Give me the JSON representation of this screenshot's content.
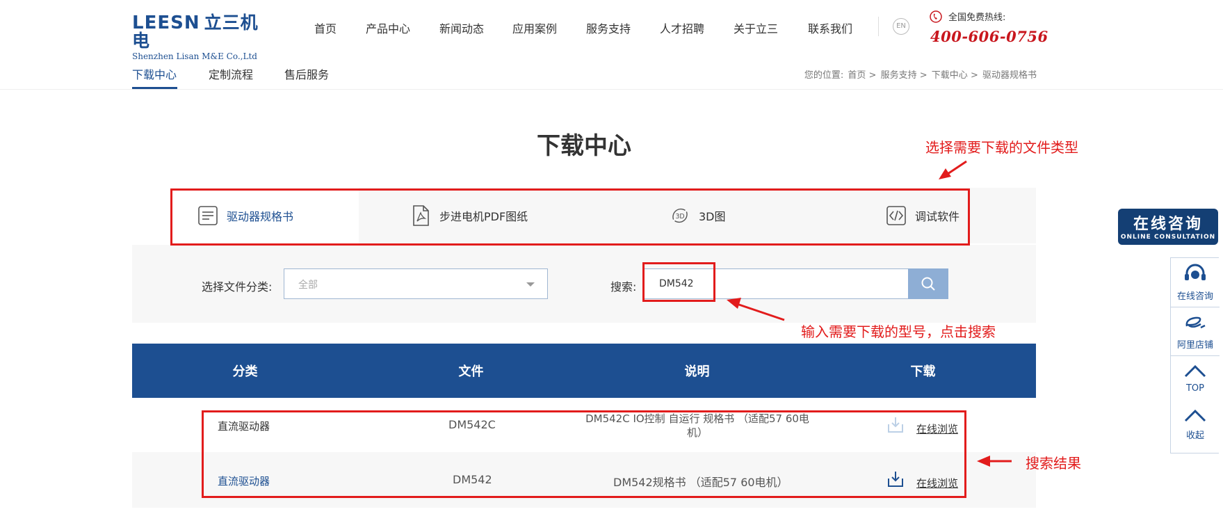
{
  "brand": {
    "logo_en": "LEESN",
    "logo_cn": "立三机电",
    "logo_sub": "Shenzhen Lisan M&E Co.,Ltd"
  },
  "nav": {
    "items": [
      "首页",
      "产品中心",
      "新闻动态",
      "应用案例",
      "服务支持",
      "人才招聘",
      "关于立三",
      "联系我们"
    ],
    "lang_button": "EN",
    "hotline_label": "全国免费热线:",
    "hotline_number": "400-606-0756"
  },
  "subnav": {
    "items": [
      "下载中心",
      "定制流程",
      "售后服务"
    ],
    "active_index": 0
  },
  "breadcrumb": {
    "prefix": "您的位置:",
    "items": [
      "首页",
      "服务支持",
      "下载中心",
      "驱动器规格书"
    ],
    "separator": ">"
  },
  "page_title": "下载中心",
  "type_tabs": {
    "items": [
      {
        "label": "驱动器规格书",
        "icon": "document-lines-icon"
      },
      {
        "label": "步进电机PDF图纸",
        "icon": "pdf-file-icon"
      },
      {
        "label": "3D图",
        "icon": "3d-rotate-icon"
      },
      {
        "label": "调试软件",
        "icon": "code-icon"
      }
    ],
    "active_index": 0
  },
  "filter": {
    "category_label": "选择文件分类:",
    "category_value": "全部",
    "search_label": "搜索:",
    "search_value": "DM542"
  },
  "table": {
    "headers": [
      "分类",
      "文件",
      "说明",
      "下载"
    ],
    "rows": [
      {
        "category": "直流驱动器",
        "file": "DM542C",
        "description": "DM542C IO控制 自运行 规格书 （适配57 60电机）",
        "action": "在线浏览"
      },
      {
        "category": "直流驱动器",
        "file": "DM542",
        "description": "DM542规格书 （适配57 60电机）",
        "action": "在线浏览"
      }
    ]
  },
  "annotations": {
    "file_type": "选择需要下载的文件类型",
    "search": "输入需要下载的型号，点击搜索",
    "results": "搜索结果"
  },
  "side": {
    "banner_big": "在线咨询",
    "banner_small": "ONLINE CONSULTATION",
    "items": [
      "在线咨询",
      "阿里店铺",
      "TOP",
      "收起"
    ]
  },
  "colors": {
    "brand_blue": "#1d4f91",
    "hotline_red": "#c8161d",
    "annotation_red": "#e21c1c"
  }
}
